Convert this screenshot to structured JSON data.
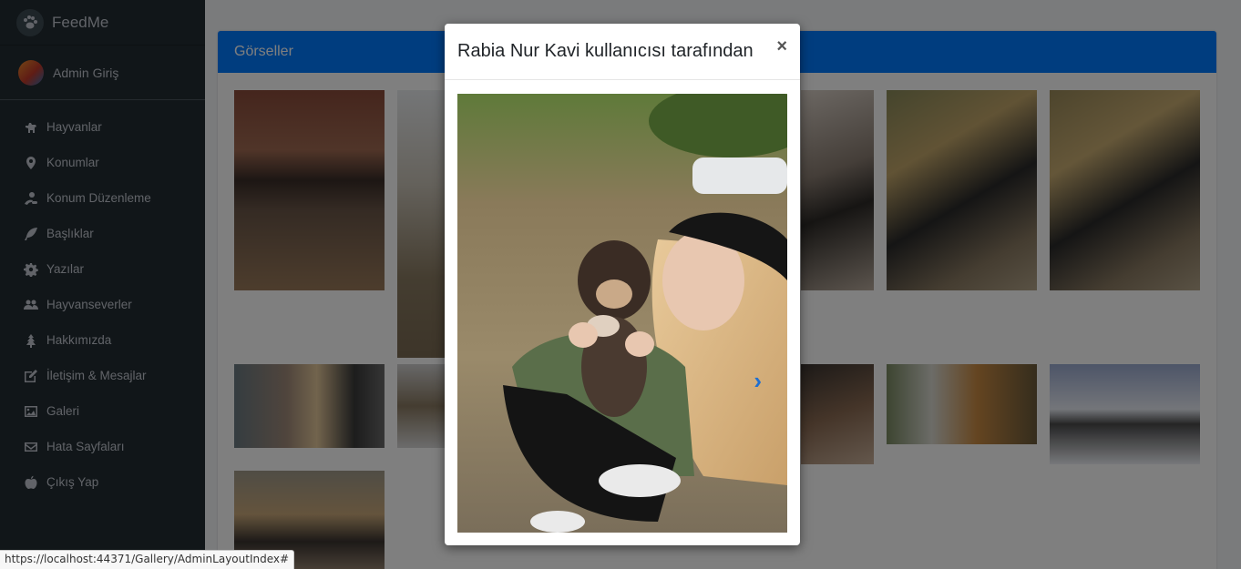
{
  "brand": {
    "name": "FeedMe",
    "icon": "paw-icon"
  },
  "user": {
    "name": "Admin Giriş"
  },
  "menu": [
    {
      "label": "Hayvanlar",
      "icon": "dog-icon"
    },
    {
      "label": "Konumlar",
      "icon": "map-marker-icon"
    },
    {
      "label": "Konum Düzenleme",
      "icon": "location-edit-icon"
    },
    {
      "label": "Başlıklar",
      "icon": "feather-icon"
    },
    {
      "label": "Yazılar",
      "icon": "gear-icon"
    },
    {
      "label": "Hayvanseverler",
      "icon": "users-icon"
    },
    {
      "label": "Hakkımızda",
      "icon": "tree-icon"
    },
    {
      "label": "İletişim & Mesajlar",
      "icon": "edit-icon"
    },
    {
      "label": "Galeri",
      "icon": "image-icon"
    },
    {
      "label": "Hata Sayfaları",
      "icon": "envelope-icon"
    },
    {
      "label": "Çıkış Yap",
      "icon": "apple-icon"
    }
  ],
  "gallery": {
    "title": "Görseller"
  },
  "modal": {
    "title": "Rabia Nur Kavi kullanıcısı tarafından",
    "close": "×",
    "next": "›"
  },
  "status": {
    "url": "https://localhost:44371/Gallery/AdminLayoutIndex#"
  },
  "colors": {
    "sidebar": "#222d32",
    "header": "#007bff",
    "overlay": "rgba(0,0,0,0.5)"
  }
}
